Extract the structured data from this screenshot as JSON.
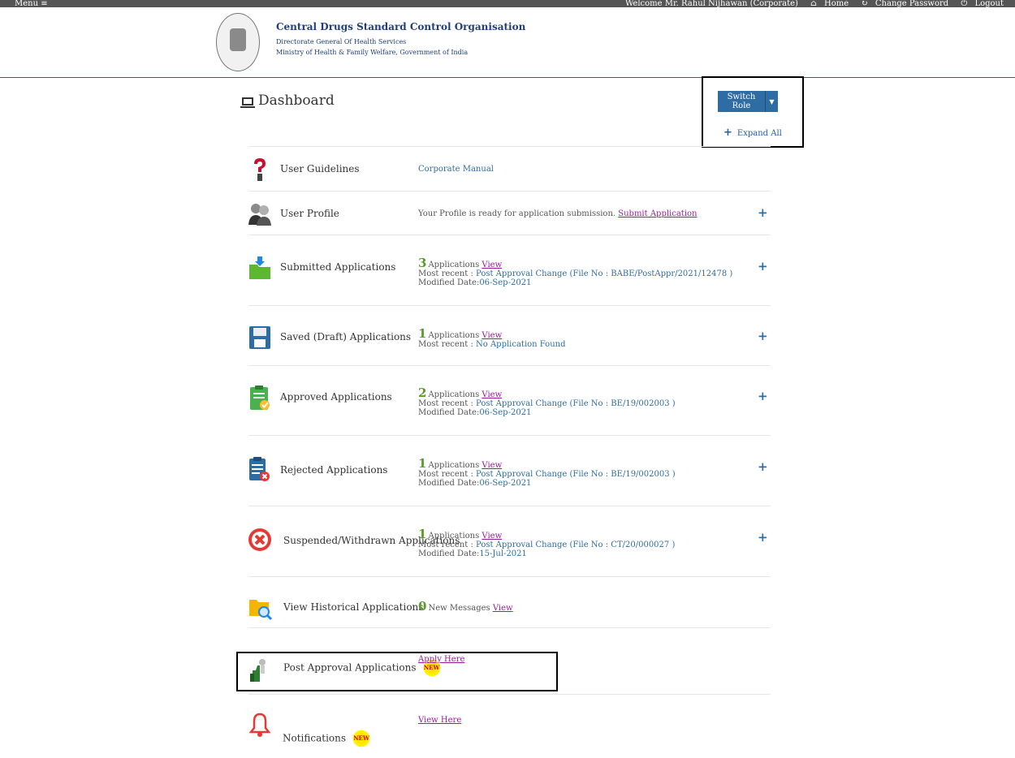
{
  "topbar": {
    "menu_label": "Menu ≡",
    "welcome": "Welcome Mr. Rahul Nijhawan  (Corporate)",
    "home": "Home",
    "change_password": "Change Password",
    "logout": "Logout"
  },
  "header": {
    "org_title": "Central Drugs Standard Control Organisation",
    "org_sub": "Directorate General Of Health Services",
    "org_sub2": "Ministry of Health & Family Welfare, Government of India"
  },
  "dashboard": {
    "title": "Dashboard",
    "switch_role": "Switch Role",
    "expand_all": "Expand All"
  },
  "rows": {
    "guidelines": {
      "label": "User Guidelines",
      "link": "Corporate Manual"
    },
    "profile": {
      "label": "User Profile",
      "text": "Your Profile is ready for application submission.",
      "link": "Submit Application"
    },
    "submitted": {
      "label": "Submitted Applications",
      "count": "3",
      "apps": "Applications",
      "view": "View",
      "recent_label": "Most recent :",
      "recent": "Post Approval Change (File No : BABE/PostAppr/2021/12478 )",
      "modified_label": "Modified Date:",
      "modified": "06-Sep-2021"
    },
    "saved": {
      "label": "Saved (Draft) Applications",
      "count": "1",
      "apps": "Applications",
      "view": "View",
      "recent_label": "Most recent :",
      "recent": "No Application Found"
    },
    "approved": {
      "label": "Approved Applications",
      "count": "2",
      "apps": "Applications",
      "view": "View",
      "recent_label": "Most recent :",
      "recent": "Post Approval Change (File No : BE/19/002003 )",
      "modified_label": "Modified Date:",
      "modified": "06-Sep-2021"
    },
    "rejected": {
      "label": "Rejected Applications",
      "count": "1",
      "apps": "Applications",
      "view": "View",
      "recent_label": "Most recent :",
      "recent": "Post Approval Change (File No : BE/19/002003 )",
      "modified_label": "Modified Date:",
      "modified": "06-Sep-2021"
    },
    "suspended": {
      "label": "Suspended/Withdrawn Applications",
      "count": "1",
      "apps": "Applications",
      "view": "View",
      "recent_label": "Most recent :",
      "recent": "Post Approval Change (File No : CT/20/000027 )",
      "modified_label": "Modified Date:",
      "modified": "15-Jul-2021"
    },
    "historical": {
      "label": "View Historical Applications",
      "count": "0",
      "text": "New Messages",
      "view": "View"
    },
    "post_approval": {
      "label": "Post Approval Applications",
      "link": "Apply Here",
      "badge": "NEW"
    },
    "notifications": {
      "label": "Notifications",
      "link": "View Here",
      "badge": "NEW"
    }
  }
}
